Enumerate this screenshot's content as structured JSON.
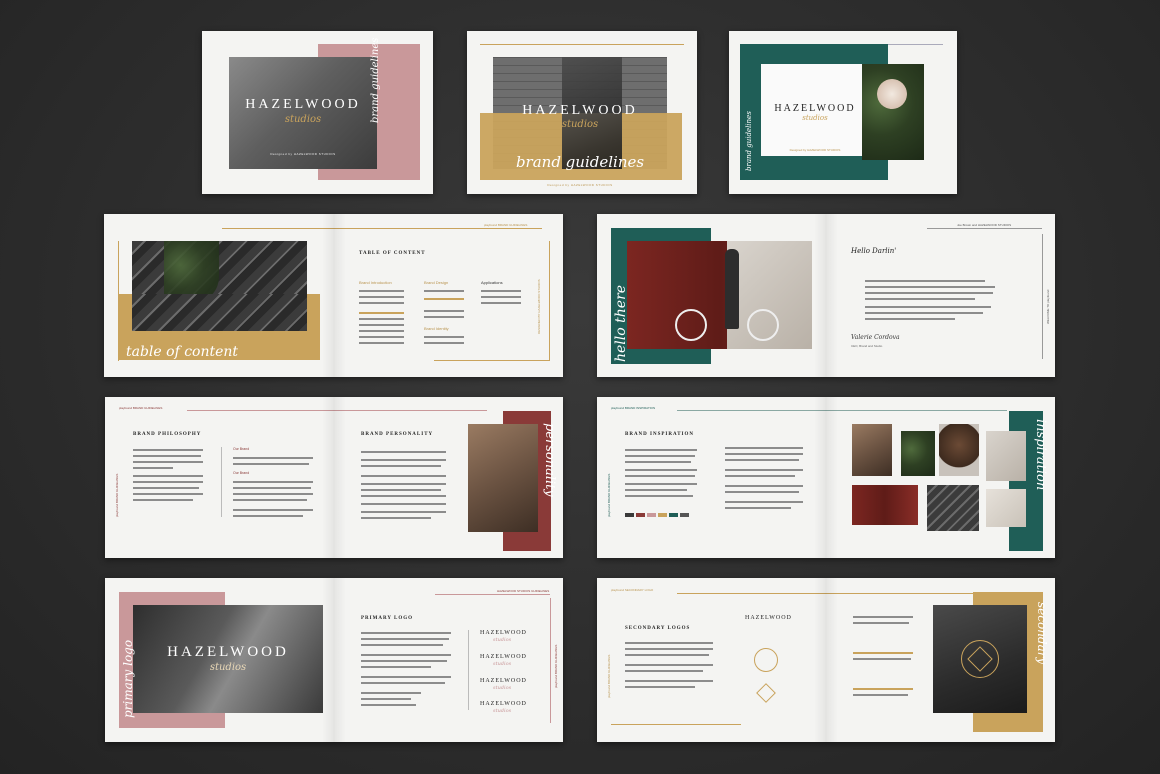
{
  "colors": {
    "pink": "#c9989a",
    "mustard": "#c9a35c",
    "teal": "#1f5e57",
    "maroon": "#8a3a38",
    "gold": "#b9944f",
    "paper": "#f4f4f2"
  },
  "cover1": {
    "title": "HAZELWOOD",
    "script": "studios",
    "side_script": "brand guidelines",
    "small": "Designed by HAZELWOOD STUDIOS"
  },
  "cover2": {
    "title": "HAZELWOOD",
    "script": "studios",
    "banner_script": "brand guidelines",
    "small": "Designed by HAZELWOOD STUDIOS"
  },
  "cover3": {
    "title": "HAZELWOOD",
    "script": "studios",
    "side_script": "brand guidelines",
    "small": "Designed by HAZELWOOD STUDIOS"
  },
  "toc": {
    "header": "playfound BRAND GUIDELINES",
    "script": "table of content",
    "heading": "TABLE OF CONTENT",
    "section_a": "Brand Introduction",
    "section_b": "Brand Design",
    "section_c": "Brand Identity",
    "section_d": "Applications",
    "vertical": "DESIGNED BY HAZELWOOD STUDIOS"
  },
  "hello": {
    "header": "Joe Brown and HAZELWOOD STUDIOS",
    "script_side": "hello there",
    "hello_script": "Hello Darlin'",
    "signature": "Valerie Cordova",
    "signature_role": "CEO, Brand and Studio",
    "vertical": "WELCOME TO playfound"
  },
  "philosophy": {
    "header": "playfound BRAND GUIDELINES",
    "heading": "BRAND PHILOSOPHY",
    "heading2": "BRAND PERSONALITY",
    "sub1": "Our Brand",
    "sub2": "Our Brand",
    "script_side": "personality",
    "vertical": "playfound BRAND GUIDELINES"
  },
  "inspiration": {
    "header": "playfound BRAND INSPIRATION",
    "heading": "BRAND INSPIRATION",
    "script_side": "inspiration",
    "vertical": "playfound BRAND GUIDELINES"
  },
  "primary_logo": {
    "header": "HAZELWOOD STUDIOS GUIDELINES",
    "title": "HAZELWOOD",
    "script": "studios",
    "side_script": "primary logo",
    "heading": "PRIMARY LOGO",
    "logo_variants": [
      "HAZELWOOD",
      "HAZELWOOD",
      "HAZELWOOD",
      "HAZELWOOD"
    ],
    "logo_script": "studios",
    "vertical": "playfound BRAND GUIDELINES"
  },
  "secondary_logo": {
    "header": "playfound SECONDARY LOGO",
    "heading": "SECONDARY LOGOS",
    "logo_word": "HAZELWOOD",
    "side_script": "secondary",
    "vertical": "playfound BRAND GUIDELINES"
  }
}
